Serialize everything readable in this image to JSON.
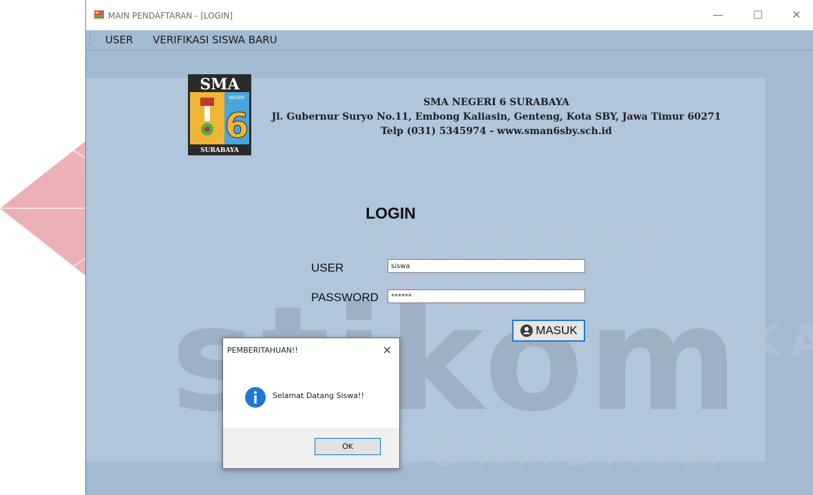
{
  "window": {
    "title": "MAIN PENDAFTARAN - [LOGIN]"
  },
  "controls": {
    "minimize": "—",
    "maximize": "☐",
    "close": "✕"
  },
  "menu": [
    {
      "label": "USER"
    },
    {
      "label": "VERIFIKASI SISWA BARU"
    }
  ],
  "logo": {
    "top": "SMA",
    "badge": "NEGERI",
    "number": "6",
    "bottom": "SURABAYA"
  },
  "school": {
    "name": "SMA NEGERI 6 SURABAYA",
    "address": "Jl. Gubernur Suryo No.11, Embong Kaliasin, Genteng, Kota SBY, Jawa Timur 60271",
    "contact": "Telp (031) 5345974 - www.sman6sby.sch.id"
  },
  "login": {
    "title": "LOGIN",
    "user_label": "USER",
    "user_value": "siswa",
    "password_label": "PASSWORD",
    "password_value": "******",
    "submit_label": "MASUK"
  },
  "dialog": {
    "title": "PEMBERITAHUAN!!",
    "close": "✕",
    "message": "Selamat Datang Siswa!!",
    "ok_label": "OK"
  },
  "watermark": {
    "line1": "INSTITUT BISNIS",
    "line2": "& INFORMATIKA",
    "brand": "stikom",
    "city": "SURABAYA"
  },
  "colors": {
    "window_bg": "#a3bad3",
    "accent": "#1e78d2",
    "watermark_red": "#e8a0a6"
  }
}
